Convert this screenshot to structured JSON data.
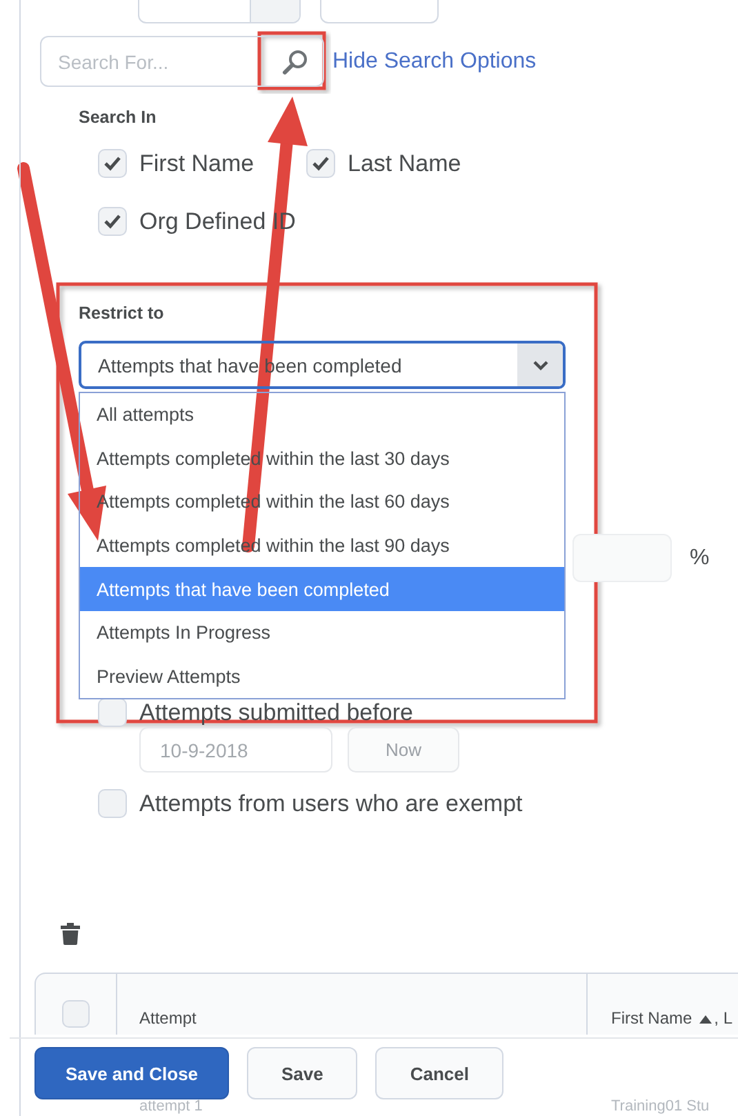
{
  "search": {
    "placeholder": "Search For...",
    "link": "Hide Search Options"
  },
  "search_in": {
    "label": "Search In",
    "options": [
      {
        "label": "First Name",
        "checked": true
      },
      {
        "label": "Last Name",
        "checked": true
      },
      {
        "label": "Org Defined ID",
        "checked": true
      }
    ]
  },
  "restrict": {
    "label": "Restrict to",
    "value": "Attempts that have been completed",
    "options": [
      {
        "label": "All attempts",
        "selected": false
      },
      {
        "label": "Attempts completed within the last 30 days",
        "selected": false
      },
      {
        "label": "Attempts completed within the last 60 days",
        "selected": false
      },
      {
        "label": "Attempts completed within the last 90 days",
        "selected": false
      },
      {
        "label": "Attempts that have been completed",
        "selected": true
      },
      {
        "label": "Attempts In Progress",
        "selected": false
      },
      {
        "label": "Preview Attempts",
        "selected": false
      }
    ]
  },
  "percent_field": {
    "unit": "%"
  },
  "submitted_before": {
    "label": "Attempts submitted before",
    "checked": false,
    "date": "10-9-2018",
    "now_button": "Now"
  },
  "exempt": {
    "label": "Attempts from users who are exempt",
    "checked": false
  },
  "table": {
    "select_all_checked": false,
    "columns": [
      {
        "label": "Attempt",
        "sort_icon": false
      },
      {
        "label": "First Name",
        "sort_icon": true,
        "suffix": ", L"
      }
    ],
    "rows": [
      {
        "cells": [
          "attempt 1",
          "Training01 Stu"
        ]
      }
    ]
  },
  "footer": {
    "buttons": [
      {
        "label": "Save and Close",
        "kind": "primary"
      },
      {
        "label": "Save",
        "kind": "secondary"
      },
      {
        "label": "Cancel",
        "kind": "secondary"
      }
    ]
  }
}
